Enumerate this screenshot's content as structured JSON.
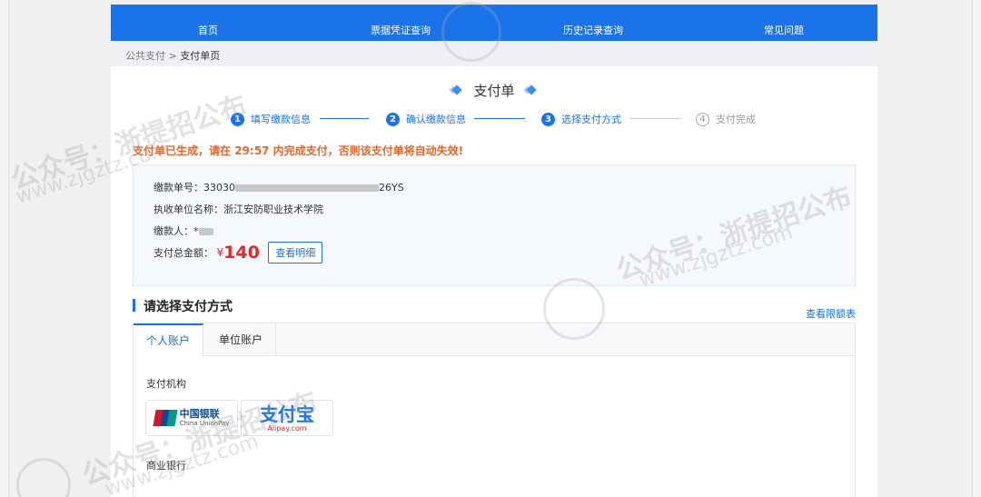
{
  "nav": {
    "items": [
      "首页",
      "票据凭证查询",
      "历史记录查询",
      "常见问题"
    ]
  },
  "breadcrumb": {
    "parent": "公共支付",
    "separator": ">",
    "current": "支付单页"
  },
  "page": {
    "title": "支付单"
  },
  "steps": [
    {
      "num": "1",
      "label": "填写缴款信息",
      "active": true
    },
    {
      "num": "2",
      "label": "确认缴款信息",
      "active": true
    },
    {
      "num": "3",
      "label": "选择支付方式",
      "active": true
    },
    {
      "num": "4",
      "label": "支付完成",
      "active": false
    }
  ],
  "warning": {
    "prefix": "支付单已生成，请在",
    "time": "29:57",
    "suffix": "内完成支付，否则该支付单将自动失效!"
  },
  "order": {
    "number_label": "缴款单号：",
    "number_start": "33030",
    "number_end": "26YS",
    "payee_label": "执收单位名称：",
    "payee": "浙江安防职业技术学院",
    "payer_label": "缴款人：",
    "payer_initial": "*",
    "total_label": "支付总金额：",
    "currency": "¥",
    "amount": "140",
    "detail_button": "查看明细"
  },
  "payment": {
    "section_title": "请选择支付方式",
    "limit_link": "查看限额表",
    "tabs": [
      "个人账户",
      "单位账户"
    ],
    "org_label": "支付机构",
    "unionpay": {
      "cn": "中国银联",
      "en": "China UnionPay"
    },
    "alipay": {
      "cn": "支付宝",
      "en": "Alipay.com"
    },
    "bank_label": "商业银行"
  },
  "watermark": {
    "text": "公众号：浙提招公布",
    "url": "www.zjgztz.com"
  },
  "colors": {
    "primary": "#1a73e8",
    "warning": "#e8662a",
    "amount": "#e8262a"
  }
}
